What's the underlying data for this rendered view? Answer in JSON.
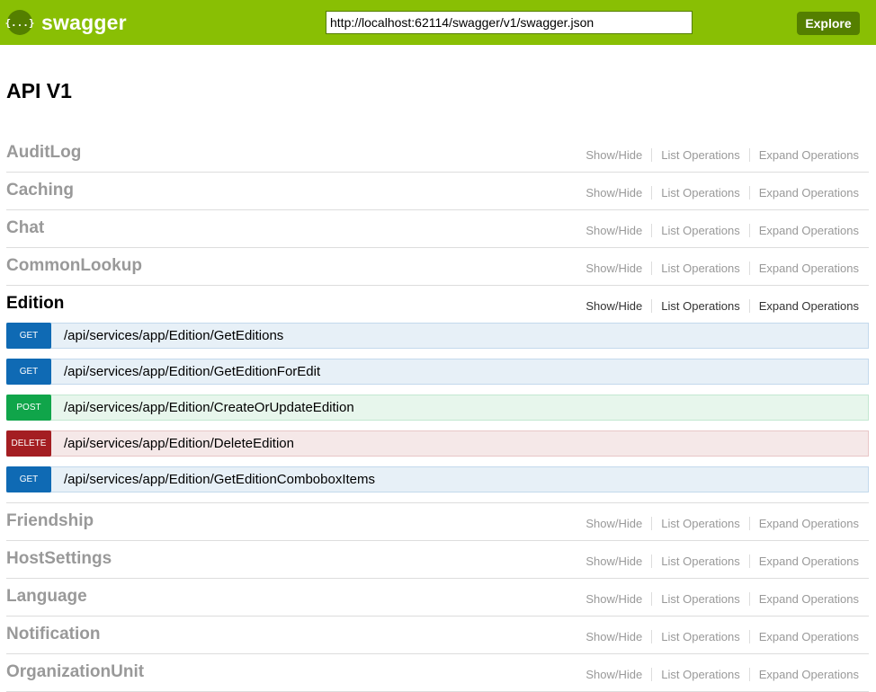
{
  "header": {
    "logo_icon": "{...}",
    "logo_text": "swagger",
    "url_value": "http://localhost:62114/swagger/v1/swagger.json",
    "explore_label": "Explore",
    "bg_color": "#89bf04",
    "accent_color": "#547f00"
  },
  "page": {
    "title": "API V1"
  },
  "resources": [
    {
      "name": "AuditLog",
      "show_hide": "Show/Hide",
      "list_ops": "List Operations",
      "expand_ops": "Expand Operations"
    },
    {
      "name": "Caching",
      "show_hide": "Show/Hide",
      "list_ops": "List Operations",
      "expand_ops": "Expand Operations"
    },
    {
      "name": "Chat",
      "show_hide": "Show/Hide",
      "list_ops": "List Operations",
      "expand_ops": "Expand Operations"
    },
    {
      "name": "CommonLookup",
      "show_hide": "Show/Hide",
      "list_ops": "List Operations",
      "expand_ops": "Expand Operations"
    },
    {
      "name": "Edition",
      "show_hide": "Show/Hide",
      "list_ops": "List Operations",
      "expand_ops": "Expand Operations",
      "expanded": true,
      "operations": [
        {
          "method": "GET",
          "path": "/api/services/app/Edition/GetEditions"
        },
        {
          "method": "GET",
          "path": "/api/services/app/Edition/GetEditionForEdit"
        },
        {
          "method": "POST",
          "path": "/api/services/app/Edition/CreateOrUpdateEdition"
        },
        {
          "method": "DELETE",
          "path": "/api/services/app/Edition/DeleteEdition"
        },
        {
          "method": "GET",
          "path": "/api/services/app/Edition/GetEditionComboboxItems"
        }
      ]
    },
    {
      "name": "Friendship",
      "show_hide": "Show/Hide",
      "list_ops": "List Operations",
      "expand_ops": "Expand Operations"
    },
    {
      "name": "HostSettings",
      "show_hide": "Show/Hide",
      "list_ops": "List Operations",
      "expand_ops": "Expand Operations"
    },
    {
      "name": "Language",
      "show_hide": "Show/Hide",
      "list_ops": "List Operations",
      "expand_ops": "Expand Operations"
    },
    {
      "name": "Notification",
      "show_hide": "Show/Hide",
      "list_ops": "List Operations",
      "expand_ops": "Expand Operations"
    },
    {
      "name": "OrganizationUnit",
      "show_hide": "Show/Hide",
      "list_ops": "List Operations",
      "expand_ops": "Expand Operations"
    }
  ],
  "method_colors": {
    "GET": "#0f6ab4",
    "POST": "#10a54a",
    "DELETE": "#a41e22"
  }
}
